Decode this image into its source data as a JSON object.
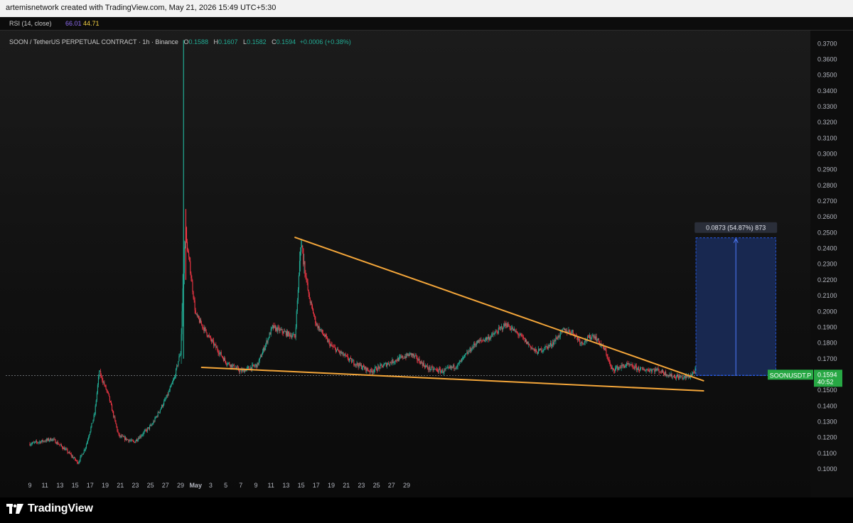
{
  "header": {
    "credit": "artemisnetwork created with TradingView.com, May 21, 2026 15:49 UTC+5:30"
  },
  "indicator": {
    "label": "RSI (14, close)",
    "value_1": "66.01",
    "value_2": "44.71"
  },
  "legend": {
    "symbol": "SOON / TetherUS PERPETUAL CONTRACT · 1h · Binance",
    "o_label": "O",
    "o_value": "0.1588",
    "h_label": "H",
    "h_value": "0.1607",
    "l_label": "L",
    "l_value": "0.1582",
    "c_label": "C",
    "c_value": "0.1594",
    "change": "+0.0006 (+0.38%)"
  },
  "chart_data": {
    "type": "candlestick",
    "y_ticks": [
      "0.3700",
      "0.3600",
      "0.3500",
      "0.3400",
      "0.3300",
      "0.3200",
      "0.3100",
      "0.3000",
      "0.2900",
      "0.2800",
      "0.2700",
      "0.2600",
      "0.2500",
      "0.2400",
      "0.2300",
      "0.2200",
      "0.2100",
      "0.2000",
      "0.1900",
      "0.1800",
      "0.1700",
      "0.1600",
      "0.1500",
      "0.1400",
      "0.1300",
      "0.1200",
      "0.1100",
      "0.1000"
    ],
    "ylim": [
      0.0973,
      0.3731
    ],
    "x_ticks": [
      "9",
      "11",
      "13",
      "15",
      "17",
      "19",
      "21",
      "23",
      "25",
      "27",
      "29",
      "May",
      "3",
      "5",
      "7",
      "9",
      "11",
      "13",
      "15",
      "17",
      "19",
      "21",
      "23",
      "25",
      "27",
      "29"
    ],
    "price_path": [
      [
        0,
        0.116
      ],
      [
        1.5,
        0.119
      ],
      [
        2.4,
        0.112
      ],
      [
        3.2,
        0.104
      ],
      [
        3.7,
        0.114
      ],
      [
        4.3,
        0.135
      ],
      [
        4.6,
        0.162
      ],
      [
        5.2,
        0.147
      ],
      [
        5.9,
        0.121
      ],
      [
        6.9,
        0.117
      ],
      [
        8.1,
        0.128
      ],
      [
        9.1,
        0.146
      ],
      [
        9.6,
        0.158
      ],
      [
        10.0,
        0.175
      ],
      [
        10.3,
        0.25
      ],
      [
        10.6,
        0.23
      ],
      [
        11.0,
        0.198
      ],
      [
        12.0,
        0.182
      ],
      [
        13.0,
        0.168
      ],
      [
        14.0,
        0.162
      ],
      [
        15.1,
        0.166
      ],
      [
        16.1,
        0.19
      ],
      [
        16.8,
        0.187
      ],
      [
        17.6,
        0.184
      ],
      [
        18.0,
        0.245
      ],
      [
        18.5,
        0.21
      ],
      [
        19.0,
        0.192
      ],
      [
        20.0,
        0.178
      ],
      [
        21.4,
        0.168
      ],
      [
        22.6,
        0.162
      ],
      [
        24.0,
        0.168
      ],
      [
        25.3,
        0.173
      ],
      [
        26.4,
        0.164
      ],
      [
        27.4,
        0.162
      ],
      [
        28.4,
        0.166
      ],
      [
        29.6,
        0.18
      ],
      [
        30.6,
        0.184
      ],
      [
        31.6,
        0.192
      ],
      [
        32.6,
        0.184
      ],
      [
        33.6,
        0.174
      ],
      [
        34.6,
        0.179
      ],
      [
        35.4,
        0.188
      ],
      [
        36.0,
        0.187
      ],
      [
        36.6,
        0.18
      ],
      [
        37.4,
        0.185
      ],
      [
        38.2,
        0.175
      ],
      [
        38.6,
        0.163
      ],
      [
        39.6,
        0.166
      ],
      [
        40.6,
        0.163
      ],
      [
        41.6,
        0.163
      ],
      [
        42.6,
        0.159
      ],
      [
        43.4,
        0.158
      ],
      [
        43.8,
        0.159
      ],
      [
        44.2,
        0.163
      ]
    ],
    "trendlines": [
      {
        "name": "upper",
        "x": [
          17.6,
          44.7
        ],
        "y": [
          0.247,
          0.156
        ]
      },
      {
        "name": "lower",
        "x": [
          11.4,
          44.7
        ],
        "y": [
          0.1645,
          0.1496
        ]
      }
    ],
    "current_price_label": "SOONUSDT.P",
    "current_price": "0.1594",
    "countdown": "40:52",
    "target_box": {
      "x": [
        44.2,
        49.5
      ],
      "y": [
        0.1594,
        0.2467
      ]
    },
    "measure_label": "0.0873 (54.87%) 873"
  },
  "branding": {
    "logo_text": "TradingView"
  },
  "colors": {
    "up": "#22ab94",
    "down": "#f23645",
    "trendline": "#f4a63a",
    "box_fill": "#1a2d5c",
    "box_border": "#2962ff",
    "price_tag": "#27a844"
  }
}
